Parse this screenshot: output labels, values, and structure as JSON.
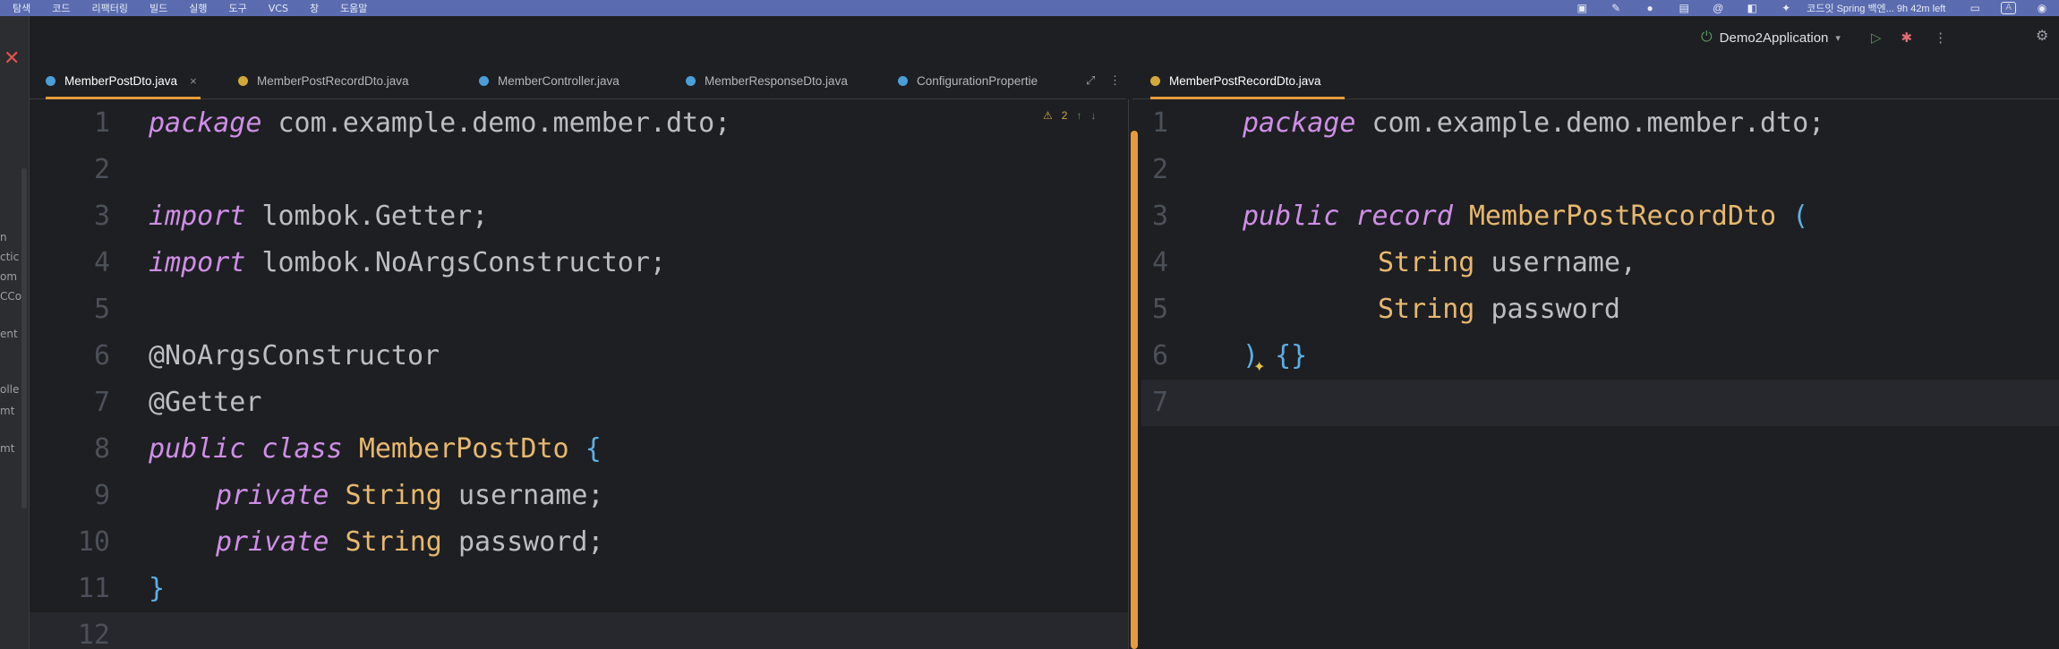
{
  "menubar": {
    "items": [
      "탐색",
      "코드",
      "리팩터링",
      "빌드",
      "실행",
      "도구",
      "VCS",
      "창",
      "도움말"
    ],
    "tray_text": "코드잇 Spring 백엔... 9h 42m left",
    "tray_box": "A"
  },
  "run": {
    "config": "Demo2Application"
  },
  "left_tabs": [
    {
      "label": "MemberPostDto.java",
      "active": true,
      "icon": "java-class-icon",
      "close": "×"
    },
    {
      "label": "MemberPostRecordDto.java",
      "active": false,
      "icon": "java-record-icon"
    },
    {
      "label": "MemberController.java",
      "active": false,
      "icon": "java-class-icon"
    },
    {
      "label": "MemberResponseDto.java",
      "active": false,
      "icon": "java-class-icon"
    },
    {
      "label": "ConfigurationPropertie",
      "active": false,
      "icon": "java-class-icon"
    }
  ],
  "right_tabs": [
    {
      "label": "MemberPostRecordDto.java",
      "active": true,
      "icon": "java-record-icon"
    }
  ],
  "inspection": {
    "warnings": "2"
  },
  "left_strip": [
    "n",
    "ctic",
    "om",
    "CCo",
    "ent",
    "olle",
    "mt",
    "mt"
  ],
  "left_editor": {
    "lines": [
      {
        "n": "1",
        "text": "package com.example.demo.member.dto;"
      },
      {
        "n": "2",
        "text": ""
      },
      {
        "n": "3",
        "text": "import lombok.Getter;"
      },
      {
        "n": "4",
        "text": "import lombok.NoArgsConstructor;"
      },
      {
        "n": "5",
        "text": ""
      },
      {
        "n": "6",
        "text": "@NoArgsConstructor"
      },
      {
        "n": "7",
        "text": "@Getter"
      },
      {
        "n": "8",
        "text": "public class MemberPostDto {"
      },
      {
        "n": "9",
        "text": "private String username;"
      },
      {
        "n": "10",
        "text": "private String password;"
      },
      {
        "n": "11",
        "text": "}"
      },
      {
        "n": "12",
        "text": ""
      }
    ]
  },
  "right_editor": {
    "lines": [
      {
        "n": "1",
        "text": "package com.example.demo.member.dto;"
      },
      {
        "n": "2",
        "text": ""
      },
      {
        "n": "3",
        "text": "public record MemberPostRecordDto ("
      },
      {
        "n": "4",
        "text": "String username,"
      },
      {
        "n": "5",
        "text": "String password"
      },
      {
        "n": "6",
        "text": ") {}"
      },
      {
        "n": "7",
        "text": ""
      }
    ]
  },
  "colors": {
    "keyword": "#cf8ee8",
    "type": "#e8b86e",
    "plain": "#bcbec4",
    "brace": "#5bb0e8",
    "active_tab_underline": "#e79b3b",
    "background": "#1e1f22"
  }
}
